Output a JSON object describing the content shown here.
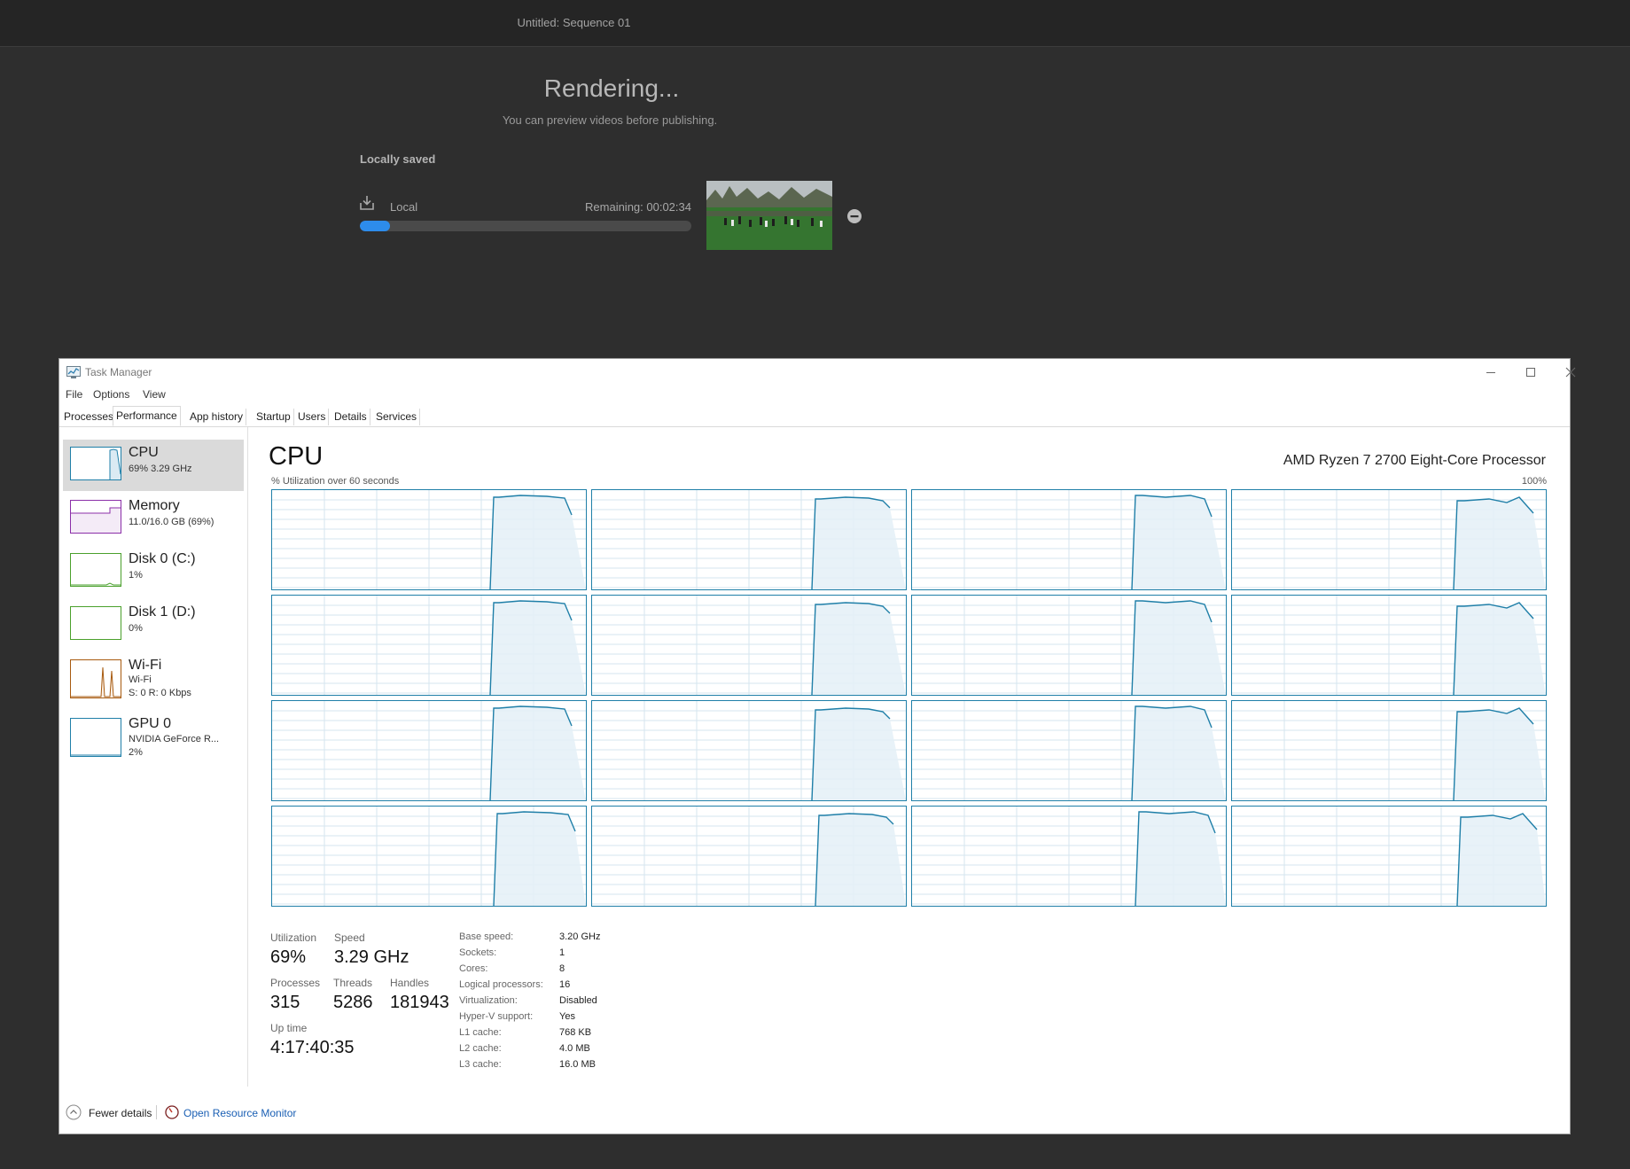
{
  "premiere": {
    "window_title": "Untitled: Sequence 01",
    "heading": "Rendering...",
    "subheading": "You can preview videos before publishing.",
    "section_label": "Locally saved",
    "destination_label": "Local",
    "remaining_text": "Remaining: 00:02:34",
    "progress_fraction": 0.09,
    "icons": [
      "download-icon",
      "remove-icon"
    ],
    "accent_color": "#2d8ceb"
  },
  "task_manager": {
    "title": "Task Manager",
    "menu": [
      "File",
      "Options",
      "View"
    ],
    "tabs": [
      "Processes",
      "Performance",
      "App history",
      "Startup",
      "Users",
      "Details",
      "Services"
    ],
    "active_tab": "Performance",
    "sidebar": [
      {
        "name": "CPU",
        "line1": "69%  3.29 GHz",
        "line2": "",
        "color": "#1f7fa8",
        "selected": true
      },
      {
        "name": "Memory",
        "line1": "11.0/16.0 GB (69%)",
        "line2": "",
        "color": "#8b2fa8",
        "selected": false
      },
      {
        "name": "Disk 0 (C:)",
        "line1": "1%",
        "line2": "",
        "color": "#4aa02c",
        "selected": false
      },
      {
        "name": "Disk 1 (D:)",
        "line1": "0%",
        "line2": "",
        "color": "#4aa02c",
        "selected": false
      },
      {
        "name": "Wi-Fi",
        "line1": "Wi-Fi",
        "line2": "S: 0 R: 0 Kbps",
        "color": "#a75a0f",
        "selected": false
      },
      {
        "name": "GPU 0",
        "line1": "NVIDIA GeForce R...",
        "line2": "2%",
        "color": "#1f7fa8",
        "selected": false
      }
    ],
    "main": {
      "title": "CPU",
      "processor": "AMD Ryzen 7 2700 Eight-Core Processor",
      "axis_label": "% Utilization over 60 seconds",
      "axis_max": "100%",
      "graph_color": "#1f7fa8",
      "logical_processor_graphs": 16
    },
    "stats": {
      "utilization_label": "Utilization",
      "utilization": "69%",
      "speed_label": "Speed",
      "speed": "3.29 GHz",
      "processes_label": "Processes",
      "processes": "315",
      "threads_label": "Threads",
      "threads": "5286",
      "handles_label": "Handles",
      "handles": "181943",
      "uptime_label": "Up time",
      "uptime": "4:17:40:35"
    },
    "specs": [
      {
        "key": "Base speed:",
        "value": "3.20 GHz"
      },
      {
        "key": "Sockets:",
        "value": "1"
      },
      {
        "key": "Cores:",
        "value": "8"
      },
      {
        "key": "Logical processors:",
        "value": "16"
      },
      {
        "key": "Virtualization:",
        "value": "Disabled"
      },
      {
        "key": "Hyper-V support:",
        "value": "Yes"
      },
      {
        "key": "L1 cache:",
        "value": "768 KB"
      },
      {
        "key": "L2 cache:",
        "value": "4.0 MB"
      },
      {
        "key": "L3 cache:",
        "value": "16.0 MB"
      }
    ],
    "footer": {
      "fewer_details": "Fewer details",
      "resource_monitor": "Open Resource Monitor"
    }
  }
}
